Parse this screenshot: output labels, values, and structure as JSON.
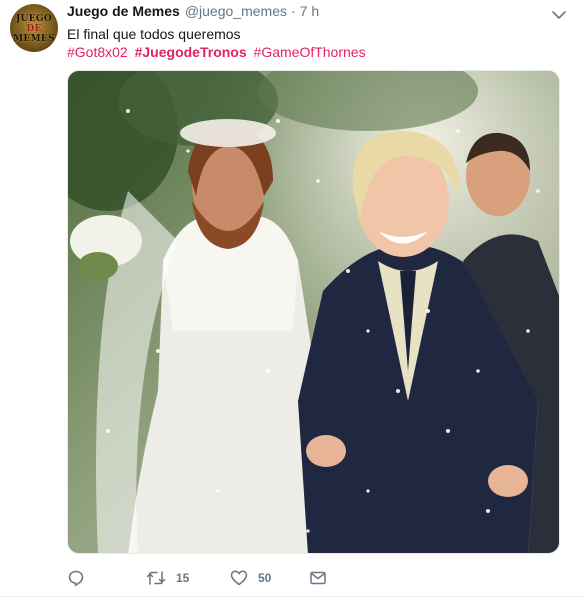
{
  "tweet": {
    "author_name": "Juego de Memes",
    "handle": "@juego_memes",
    "separator": "·",
    "time": "7 h",
    "avatar_text": [
      "JUEGO",
      "DE",
      "MEMES"
    ],
    "text": "El final que todos queremos",
    "hashtags": [
      "#Got8x02",
      "#JuegodeTronos",
      "#GameOfThornes"
    ],
    "hashtag_color": "#e0245e",
    "media": {
      "kind": "photo"
    }
  },
  "actions": {
    "reply_icon": "reply-icon",
    "retweet_icon": "retweet-icon",
    "retweet_count": "15",
    "like_icon": "heart-icon",
    "like_count": "50",
    "dm_icon": "envelope-icon"
  },
  "colors": {
    "text": "#14171a",
    "secondary": "#657786",
    "border": "#e6ecf0"
  }
}
